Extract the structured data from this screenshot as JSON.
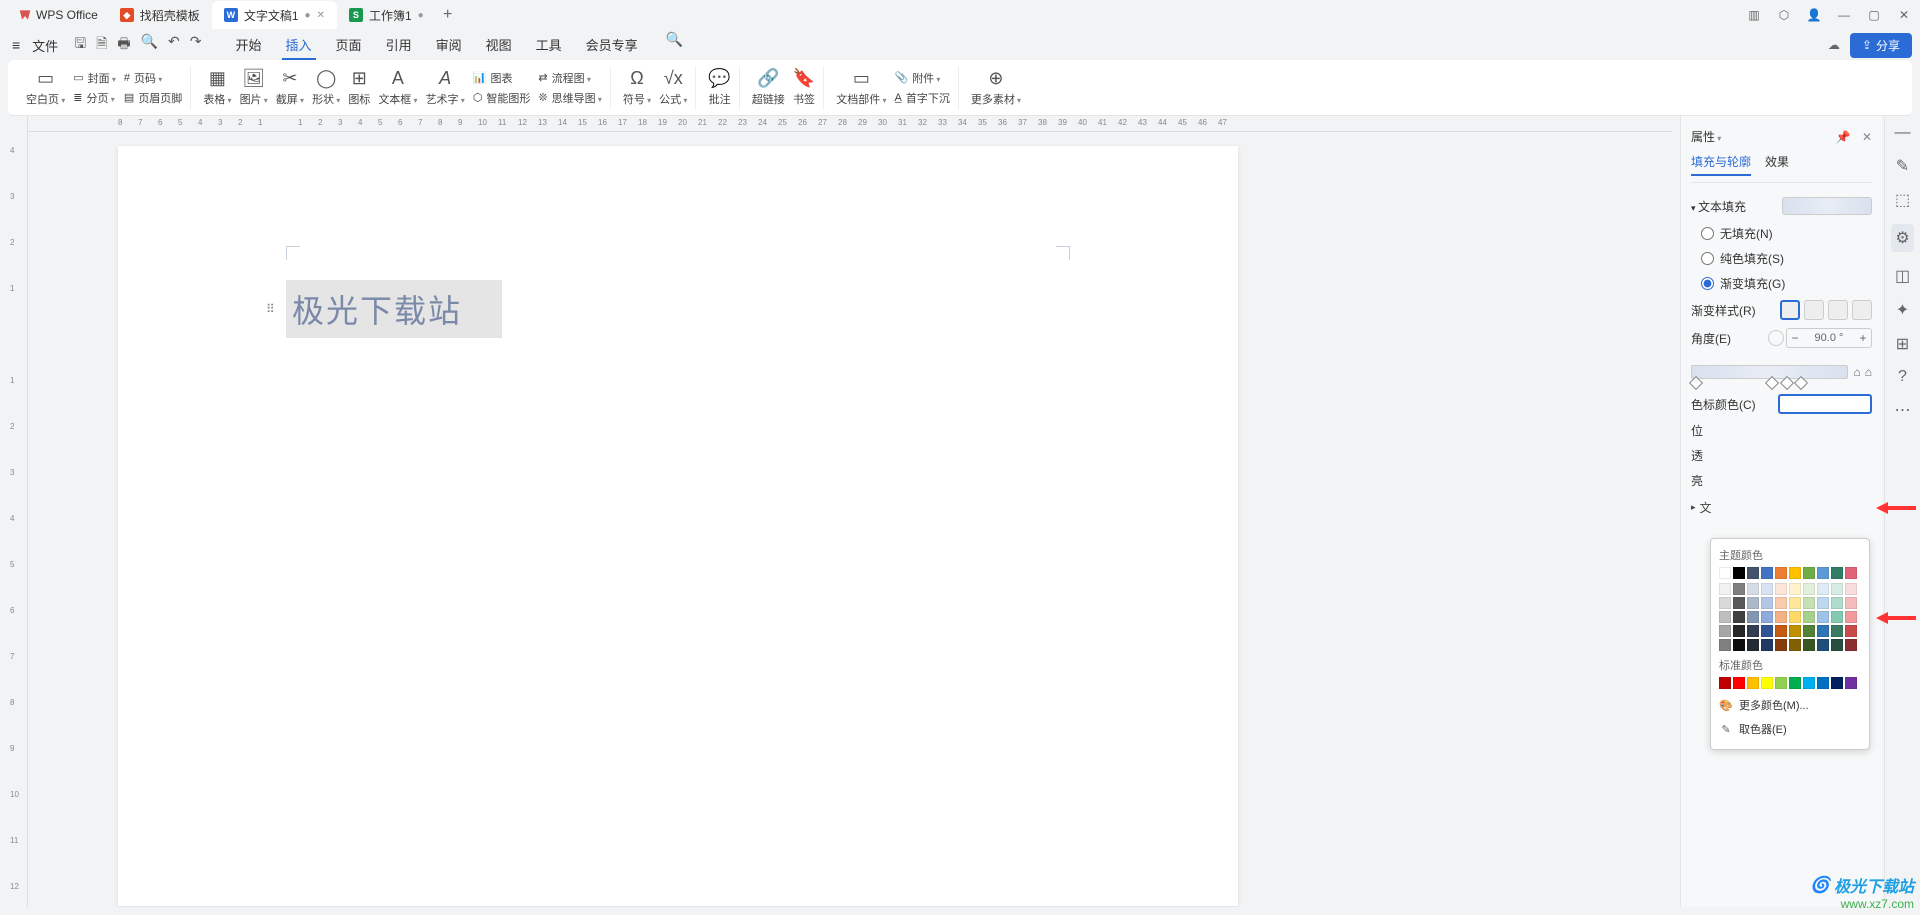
{
  "app": {
    "name": "WPS Office"
  },
  "tabs": [
    {
      "icon_bg": "#e34c26",
      "icon_txt": "",
      "label": "找稻壳模板",
      "active": false
    },
    {
      "icon_bg": "#2b6bd6",
      "icon_txt": "W",
      "label": "文字文稿1",
      "active": true
    },
    {
      "icon_bg": "#1a9850",
      "icon_txt": "S",
      "label": "工作簿1",
      "active": false
    }
  ],
  "add_tab": "+",
  "file_label": "文件",
  "menus": [
    "开始",
    "插入",
    "页面",
    "引用",
    "审阅",
    "视图",
    "工具",
    "会员专享"
  ],
  "active_menu": "插入",
  "share_label": "分享",
  "ribbon": {
    "blank_page": "空白页",
    "cover": "封面",
    "page_number": "页码",
    "section": "分页",
    "header_footer": "页眉页脚",
    "table": "表格",
    "picture": "图片",
    "screenshot": "截屏",
    "shape": "形状",
    "icons": "图标",
    "textbox": "文本框",
    "wordart": "艺术字",
    "chart": "图表",
    "flowchart": "流程图",
    "smartart": "智能图形",
    "mindmap": "思维导图",
    "symbol": "符号",
    "equation": "公式",
    "comment": "批注",
    "hyperlink": "超链接",
    "bookmark": "书签",
    "doc_parts": "文档部件",
    "dropcap": "首字下沉",
    "attachment": "附件",
    "more": "更多素材"
  },
  "ruler_h": [
    "8",
    "7",
    "6",
    "5",
    "4",
    "3",
    "2",
    "1",
    "",
    "1",
    "2",
    "3",
    "4",
    "5",
    "6",
    "7",
    "8",
    "9",
    "10",
    "11",
    "12",
    "13",
    "14",
    "15",
    "16",
    "17",
    "18",
    "19",
    "20",
    "21",
    "22",
    "23",
    "24",
    "25",
    "26",
    "27",
    "28",
    "29",
    "30",
    "31",
    "32",
    "33",
    "34",
    "35",
    "36",
    "37",
    "38",
    "39",
    "40",
    "41",
    "42",
    "43",
    "44",
    "45",
    "46",
    "47"
  ],
  "ruler_v": [
    "4",
    "3",
    "2",
    "1",
    "",
    "1",
    "2",
    "3",
    "4",
    "5",
    "6",
    "7",
    "8",
    "9",
    "10",
    "11",
    "12"
  ],
  "art_text": "极光下载站",
  "panel": {
    "title": "属性",
    "tab_fill": "填充与轮廓",
    "tab_effect": "效果",
    "section_textfill": "文本填充",
    "fill_none": "无填充(N)",
    "fill_solid": "纯色填充(S)",
    "fill_gradient": "渐变填充(G)",
    "grad_style": "渐变样式(R)",
    "angle": "角度(E)",
    "angle_value": "90.0",
    "angle_unit": "°",
    "stop_color": "色标颜色(C)",
    "position": "位",
    "transparency": "透",
    "brightness": "亮",
    "section_textoutline": "文"
  },
  "color_popover": {
    "theme_title": "主题颜色",
    "std_title": "标准颜色",
    "more": "更多颜色(M)...",
    "eyedropper": "取色器(E)",
    "theme_row": [
      "#ffffff",
      "#000000",
      "#44546a",
      "#4472c4",
      "#ed7d31",
      "#ffc000",
      "#70ad47",
      "#5b9bd5",
      "#2e7d64",
      "#e06377"
    ],
    "shade_rows": [
      [
        "#f2f2f2",
        "#7f7f7f",
        "#d6dce5",
        "#d9e2f3",
        "#fbe5d6",
        "#fff2cc",
        "#e2efda",
        "#deebf7",
        "#d6ece4",
        "#f9dcdc"
      ],
      [
        "#d9d9d9",
        "#595959",
        "#adb9ca",
        "#b4c7e7",
        "#f8cbad",
        "#ffe699",
        "#c5e0b4",
        "#bdd7ee",
        "#aedbcb",
        "#f4bcbc"
      ],
      [
        "#bfbfbf",
        "#404040",
        "#8497b0",
        "#8faadc",
        "#f4b183",
        "#ffd966",
        "#a9d18e",
        "#9dc3e6",
        "#84c9b0",
        "#ef9b9b"
      ],
      [
        "#a6a6a6",
        "#262626",
        "#333f50",
        "#2f5597",
        "#c55a11",
        "#bf9000",
        "#548235",
        "#2e75b6",
        "#3b7a62",
        "#c94c4c"
      ],
      [
        "#808080",
        "#0d0d0d",
        "#222a35",
        "#1f3864",
        "#843c0c",
        "#806000",
        "#385723",
        "#1f4e79",
        "#274e3e",
        "#8a2f2f"
      ]
    ],
    "std_row": [
      "#c00000",
      "#ff0000",
      "#ffc000",
      "#ffff00",
      "#92d050",
      "#00b050",
      "#00b0f0",
      "#0070c0",
      "#002060",
      "#7030a0"
    ]
  },
  "watermark": {
    "line1": "极光下载站",
    "line2": "www.xz7.com"
  }
}
